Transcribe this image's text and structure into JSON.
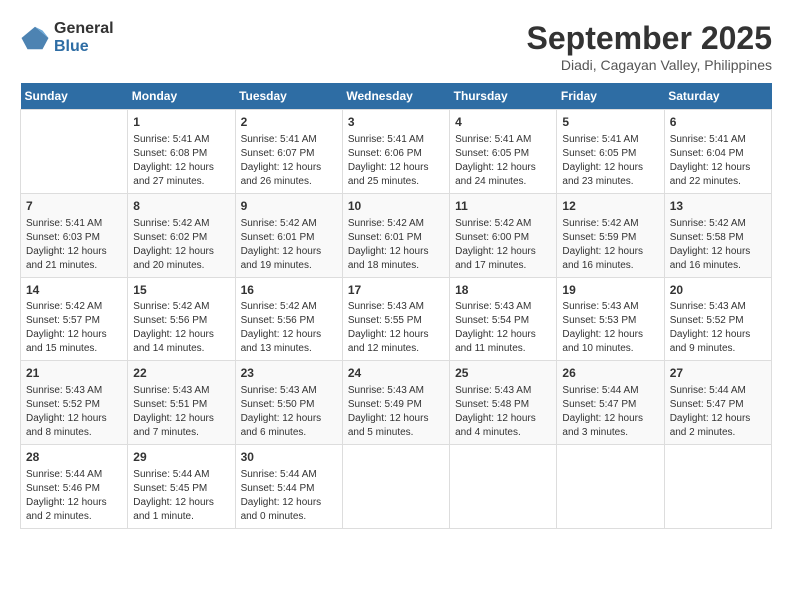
{
  "logo": {
    "general": "General",
    "blue": "Blue"
  },
  "title": "September 2025",
  "subtitle": "Diadi, Cagayan Valley, Philippines",
  "days_header": [
    "Sunday",
    "Monday",
    "Tuesday",
    "Wednesday",
    "Thursday",
    "Friday",
    "Saturday"
  ],
  "weeks": [
    [
      {
        "day": "",
        "info": ""
      },
      {
        "day": "1",
        "info": "Sunrise: 5:41 AM\nSunset: 6:08 PM\nDaylight: 12 hours\nand 27 minutes."
      },
      {
        "day": "2",
        "info": "Sunrise: 5:41 AM\nSunset: 6:07 PM\nDaylight: 12 hours\nand 26 minutes."
      },
      {
        "day": "3",
        "info": "Sunrise: 5:41 AM\nSunset: 6:06 PM\nDaylight: 12 hours\nand 25 minutes."
      },
      {
        "day": "4",
        "info": "Sunrise: 5:41 AM\nSunset: 6:05 PM\nDaylight: 12 hours\nand 24 minutes."
      },
      {
        "day": "5",
        "info": "Sunrise: 5:41 AM\nSunset: 6:05 PM\nDaylight: 12 hours\nand 23 minutes."
      },
      {
        "day": "6",
        "info": "Sunrise: 5:41 AM\nSunset: 6:04 PM\nDaylight: 12 hours\nand 22 minutes."
      }
    ],
    [
      {
        "day": "7",
        "info": "Sunrise: 5:41 AM\nSunset: 6:03 PM\nDaylight: 12 hours\nand 21 minutes."
      },
      {
        "day": "8",
        "info": "Sunrise: 5:42 AM\nSunset: 6:02 PM\nDaylight: 12 hours\nand 20 minutes."
      },
      {
        "day": "9",
        "info": "Sunrise: 5:42 AM\nSunset: 6:01 PM\nDaylight: 12 hours\nand 19 minutes."
      },
      {
        "day": "10",
        "info": "Sunrise: 5:42 AM\nSunset: 6:01 PM\nDaylight: 12 hours\nand 18 minutes."
      },
      {
        "day": "11",
        "info": "Sunrise: 5:42 AM\nSunset: 6:00 PM\nDaylight: 12 hours\nand 17 minutes."
      },
      {
        "day": "12",
        "info": "Sunrise: 5:42 AM\nSunset: 5:59 PM\nDaylight: 12 hours\nand 16 minutes."
      },
      {
        "day": "13",
        "info": "Sunrise: 5:42 AM\nSunset: 5:58 PM\nDaylight: 12 hours\nand 16 minutes."
      }
    ],
    [
      {
        "day": "14",
        "info": "Sunrise: 5:42 AM\nSunset: 5:57 PM\nDaylight: 12 hours\nand 15 minutes."
      },
      {
        "day": "15",
        "info": "Sunrise: 5:42 AM\nSunset: 5:56 PM\nDaylight: 12 hours\nand 14 minutes."
      },
      {
        "day": "16",
        "info": "Sunrise: 5:42 AM\nSunset: 5:56 PM\nDaylight: 12 hours\nand 13 minutes."
      },
      {
        "day": "17",
        "info": "Sunrise: 5:43 AM\nSunset: 5:55 PM\nDaylight: 12 hours\nand 12 minutes."
      },
      {
        "day": "18",
        "info": "Sunrise: 5:43 AM\nSunset: 5:54 PM\nDaylight: 12 hours\nand 11 minutes."
      },
      {
        "day": "19",
        "info": "Sunrise: 5:43 AM\nSunset: 5:53 PM\nDaylight: 12 hours\nand 10 minutes."
      },
      {
        "day": "20",
        "info": "Sunrise: 5:43 AM\nSunset: 5:52 PM\nDaylight: 12 hours\nand 9 minutes."
      }
    ],
    [
      {
        "day": "21",
        "info": "Sunrise: 5:43 AM\nSunset: 5:52 PM\nDaylight: 12 hours\nand 8 minutes."
      },
      {
        "day": "22",
        "info": "Sunrise: 5:43 AM\nSunset: 5:51 PM\nDaylight: 12 hours\nand 7 minutes."
      },
      {
        "day": "23",
        "info": "Sunrise: 5:43 AM\nSunset: 5:50 PM\nDaylight: 12 hours\nand 6 minutes."
      },
      {
        "day": "24",
        "info": "Sunrise: 5:43 AM\nSunset: 5:49 PM\nDaylight: 12 hours\nand 5 minutes."
      },
      {
        "day": "25",
        "info": "Sunrise: 5:43 AM\nSunset: 5:48 PM\nDaylight: 12 hours\nand 4 minutes."
      },
      {
        "day": "26",
        "info": "Sunrise: 5:44 AM\nSunset: 5:47 PM\nDaylight: 12 hours\nand 3 minutes."
      },
      {
        "day": "27",
        "info": "Sunrise: 5:44 AM\nSunset: 5:47 PM\nDaylight: 12 hours\nand 2 minutes."
      }
    ],
    [
      {
        "day": "28",
        "info": "Sunrise: 5:44 AM\nSunset: 5:46 PM\nDaylight: 12 hours\nand 2 minutes."
      },
      {
        "day": "29",
        "info": "Sunrise: 5:44 AM\nSunset: 5:45 PM\nDaylight: 12 hours\nand 1 minute."
      },
      {
        "day": "30",
        "info": "Sunrise: 5:44 AM\nSunset: 5:44 PM\nDaylight: 12 hours\nand 0 minutes."
      },
      {
        "day": "",
        "info": ""
      },
      {
        "day": "",
        "info": ""
      },
      {
        "day": "",
        "info": ""
      },
      {
        "day": "",
        "info": ""
      }
    ]
  ]
}
